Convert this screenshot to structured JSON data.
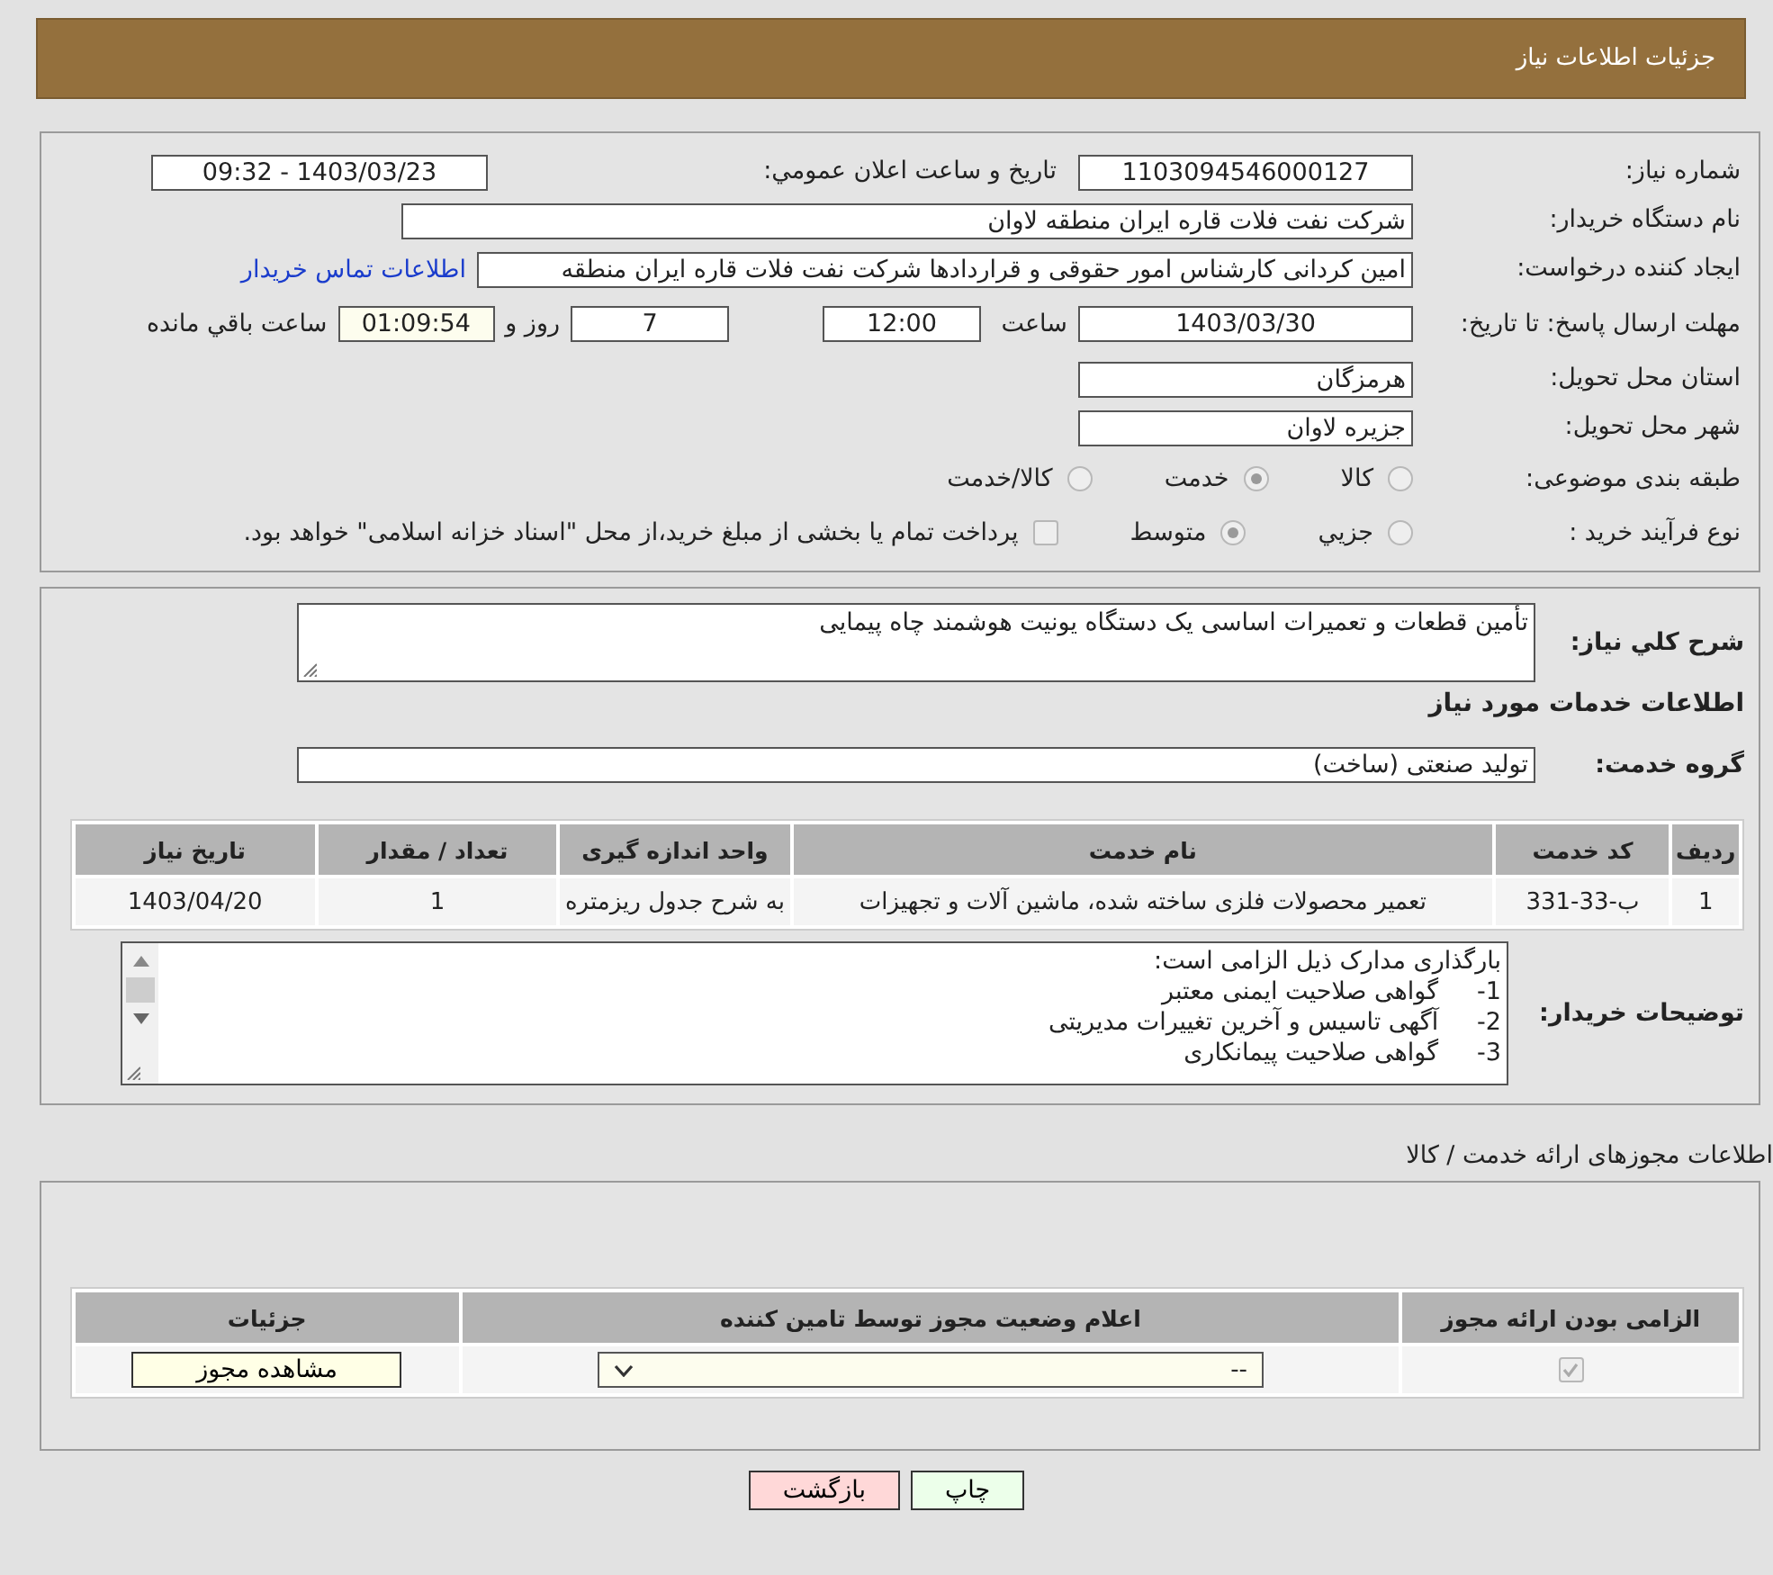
{
  "header": {
    "title": "جزئیات اطلاعات نیاز"
  },
  "need_number": {
    "label": "شماره نیاز:",
    "value": "1103094546000127"
  },
  "announce": {
    "label": "تاریخ و ساعت اعلان عمومي:",
    "value": "1403/03/23 - 09:32"
  },
  "buyer_org": {
    "label": "نام دستگاه خریدار:",
    "value": "شرکت نفت فلات قاره ایران منطقه لاوان"
  },
  "creator": {
    "label": "ایجاد کننده درخواست:",
    "value": "امین کردانی کارشناس امور حقوقی و قراردادها شرکت نفت فلات قاره ایران منطقه",
    "link": "اطلاعات تماس خریدار"
  },
  "deadline": {
    "label": "مهلت ارسال پاسخ: تا تاریخ:",
    "date": "1403/03/30",
    "time_label": "ساعت",
    "time": "12:00",
    "days": "7",
    "days_label": "روز و",
    "remaining": "01:09:54",
    "remaining_label": "ساعت باقي مانده"
  },
  "province": {
    "label": "استان محل تحویل:",
    "value": "هرمزگان"
  },
  "city": {
    "label": "شهر محل تحویل:",
    "value": "جزیره لاوان"
  },
  "category": {
    "label": "طبقه بندی موضوعی:",
    "options": [
      {
        "label": "کالا",
        "selected": false
      },
      {
        "label": "خدمت",
        "selected": true
      },
      {
        "label": "کالا/خدمت",
        "selected": false
      }
    ]
  },
  "process": {
    "label": "نوع فرآیند خرید :",
    "options": [
      {
        "label": "جزيي",
        "selected": false
      },
      {
        "label": "متوسط",
        "selected": true
      }
    ],
    "payment": {
      "label": "پرداخت تمام یا بخشی از مبلغ خرید،از محل \"اسناد خزانه اسلامی\" خواهد بود.",
      "checked": false
    }
  },
  "description": {
    "label": "شرح كلي نياز:",
    "value": "تأمین قطعات و تعمیرات اساسی یک دستگاه یونیت هوشمند چاه پیمایی"
  },
  "services": {
    "title": "اطلاعات خدمات مورد نیاز",
    "group_label": "گروه خدمت:",
    "group_value": "تولید صنعتی (ساخت)",
    "columns": [
      "ردیف",
      "کد خدمت",
      "نام خدمت",
      "واحد اندازه گیری",
      "تعداد / مقدار",
      "تاریخ نیاز"
    ],
    "rows": [
      [
        "1",
        "ب-33-331",
        "تعمیر محصولات فلزی ساخته شده، ماشین آلات و تجهیزات",
        "به شرح جدول ریزمتره",
        "1",
        "1403/04/20"
      ]
    ]
  },
  "buyer_notes": {
    "label": "توضیحات خریدار:",
    "lines": [
      "بارگذاری مدارک ذیل الزامی است:",
      "1-     گواهی صلاحیت ایمنی معتبر",
      "2-     آگهی تاسیس و آخرین تغییرات مدیریتی",
      "3-     گواهی صلاحیت پیمانکاری"
    ]
  },
  "permits": {
    "title": "اطلاعات مجوزهای ارائه خدمت / کالا",
    "columns": [
      "الزامی بودن ارائه مجوز",
      "اعلام وضعیت مجوز توسط تامین کننده",
      "جزئیات"
    ],
    "rows": [
      {
        "required": true,
        "status": "--",
        "details_button": "مشاهده مجوز"
      }
    ]
  },
  "buttons": [
    {
      "label": "چاپ",
      "kind": "print"
    },
    {
      "label": "بازگشت",
      "kind": "back"
    }
  ]
}
